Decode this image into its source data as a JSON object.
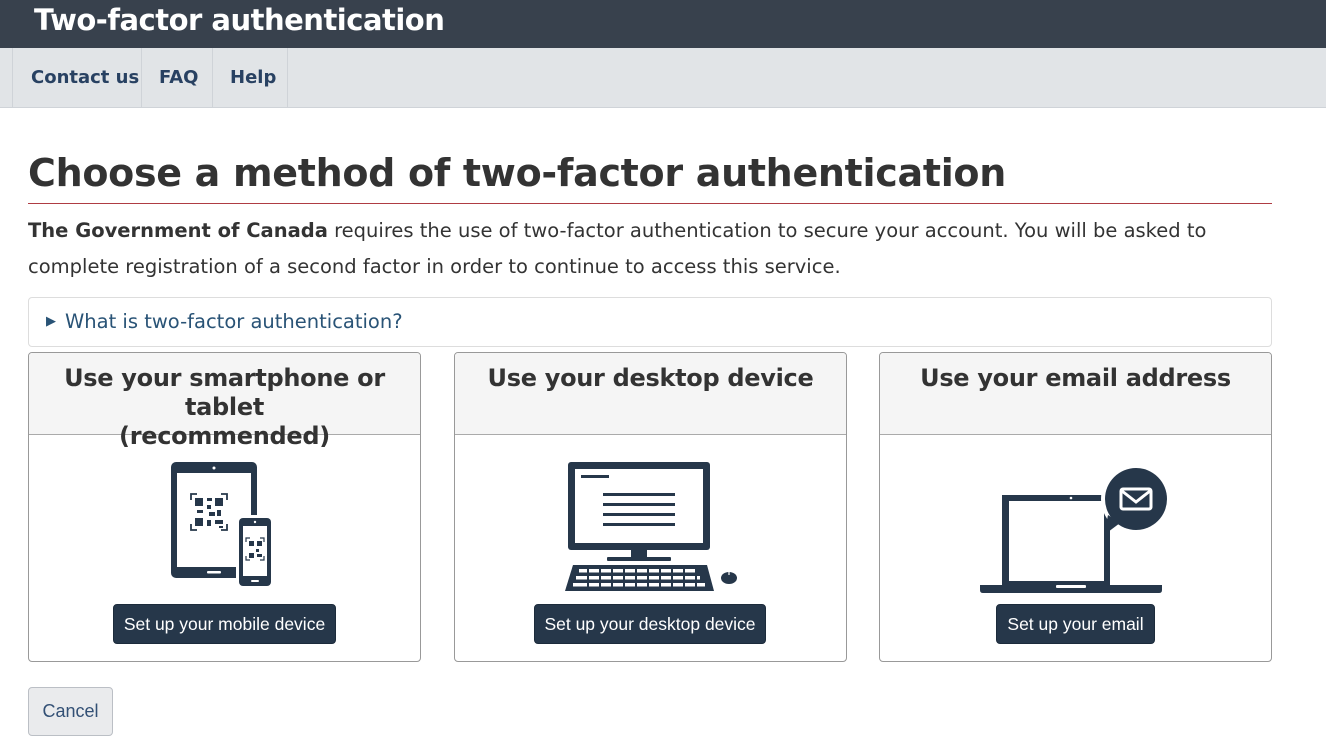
{
  "header": {
    "title": "Two-factor authentication"
  },
  "nav": {
    "items": [
      {
        "label": "Contact us"
      },
      {
        "label": "FAQ"
      },
      {
        "label": "Help"
      }
    ]
  },
  "main": {
    "title": "Choose a method of two-factor authentication",
    "intro_strong": "The Government of Canada",
    "intro_rest": " requires the use of two-factor authentication to secure your account. You will be asked to complete registration of a second factor in order to continue to access this service.",
    "details_summary": "What is two-factor authentication?",
    "details_icon": "triangle-right-icon"
  },
  "cards": [
    {
      "title_line1": "Use your smartphone or tablet",
      "title_line2": "(recommended)",
      "icon": "tablet-phone-qr-icon",
      "button": "Set up your mobile device"
    },
    {
      "title_line1": "Use your desktop device",
      "title_line2": "",
      "icon": "desktop-computer-icon",
      "button": "Set up your desktop device"
    },
    {
      "title_line1": "Use your email address",
      "title_line2": "",
      "icon": "laptop-email-icon",
      "button": "Set up your email"
    }
  ],
  "actions": {
    "cancel": "Cancel"
  },
  "colors": {
    "header_bg": "#38414d",
    "nav_bg": "#e1e4e7",
    "link": "#284162",
    "accent_rule": "#af3c43",
    "button_bg": "#26374a",
    "icon": "#26374a"
  }
}
